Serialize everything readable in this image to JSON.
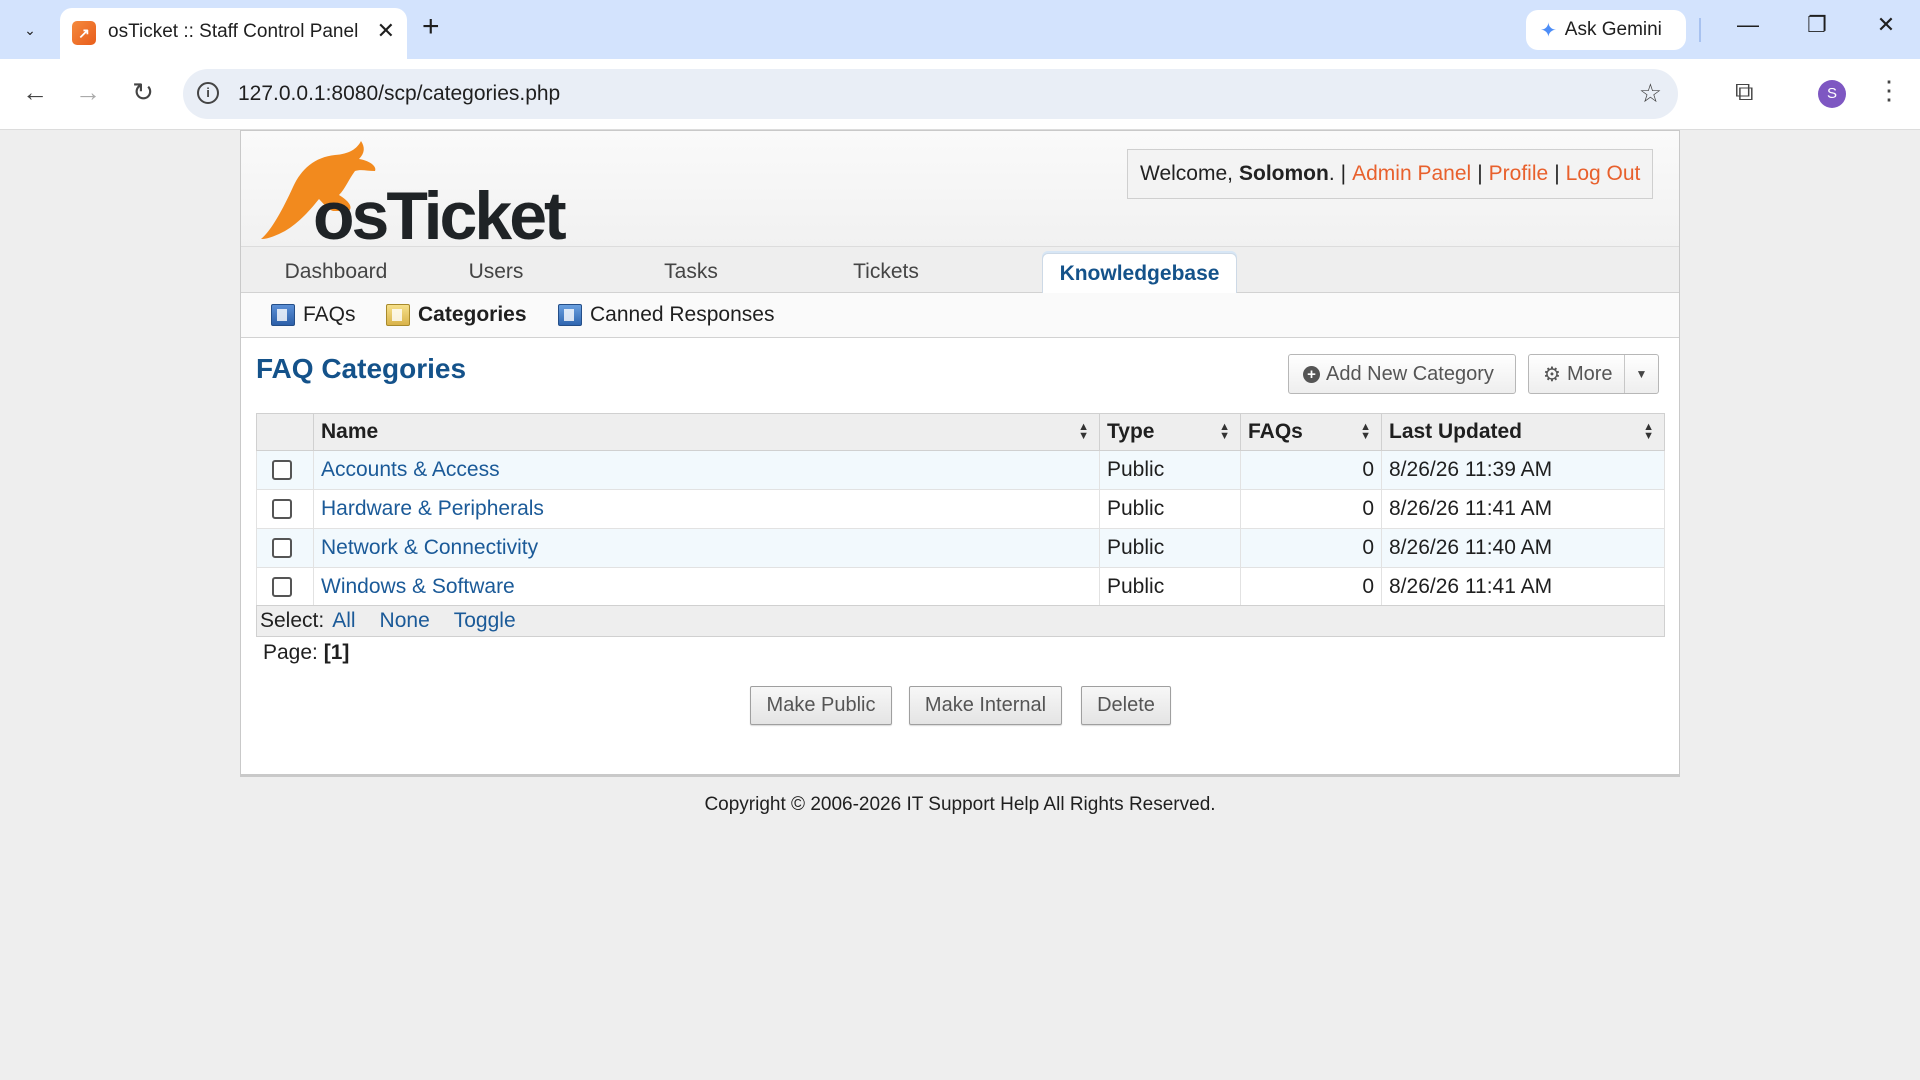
{
  "browser": {
    "tab_title": "osTicket :: Staff Control Panel",
    "url": "127.0.0.1:8080/scp/categories.php",
    "gemini_label": "Ask Gemini",
    "profile_initial": "S"
  },
  "header": {
    "logo_text": "osTicket",
    "welcome_prefix": "Welcome,",
    "user_name": "Solomon",
    "welcome_suffix": ".",
    "separator": "|",
    "links": [
      "Admin Panel",
      "Profile",
      "Log Out"
    ]
  },
  "nav": {
    "tabs": [
      "Dashboard",
      "Users",
      "Tasks",
      "Tickets",
      "Knowledgebase"
    ],
    "active_tab": "Knowledgebase"
  },
  "subnav": {
    "items": [
      "FAQs",
      "Categories",
      "Canned Responses"
    ],
    "active": "Categories"
  },
  "main": {
    "title": "FAQ Categories",
    "add_button": "Add New Category",
    "more_button": "More",
    "columns": [
      "Name",
      "Type",
      "FAQs",
      "Last Updated"
    ],
    "rows": [
      {
        "name": "Accounts & Access",
        "type": "Public",
        "faqs": "0",
        "updated": "8/26/26 11:39 AM"
      },
      {
        "name": "Hardware & Peripherals",
        "type": "Public",
        "faqs": "0",
        "updated": "8/26/26 11:41 AM"
      },
      {
        "name": "Network & Connectivity",
        "type": "Public",
        "faqs": "0",
        "updated": "8/26/26 11:40 AM"
      },
      {
        "name": "Windows & Software",
        "type": "Public",
        "faqs": "0",
        "updated": "8/26/26 11:41 AM"
      }
    ],
    "select_label": "Select:",
    "select_links": [
      "All",
      "None",
      "Toggle"
    ],
    "page_label": "Page:",
    "page_current": "[1]",
    "actions": [
      "Make Public",
      "Make Internal",
      "Delete"
    ]
  },
  "footer": {
    "text": "Copyright © 2006-2026 IT Support Help All Rights Reserved."
  },
  "colors": {
    "link": "#1b5a98",
    "title": "#14528a",
    "accent_link": "#e8602c",
    "logo_orange": "#f28a1e"
  }
}
